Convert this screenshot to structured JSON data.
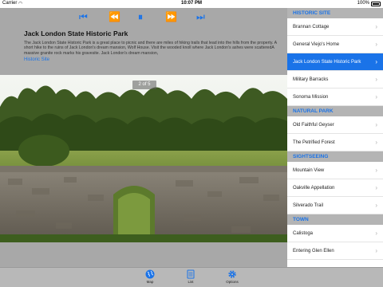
{
  "status_bar": {
    "carrier": "Carrier",
    "time": "10:07 PM",
    "battery": "100%"
  },
  "media": {
    "first": "⏮",
    "rewind": "⏪",
    "pause": "⏸",
    "ffwd": "⏩",
    "last": "⏭"
  },
  "detail": {
    "title": "Jack London State Historic Park",
    "description": "The Jack London State Historic Park is a great place to picnic and there are miles of hiking trails that lead into the hills from the property. A short hike to the ruins of Jack London's dream mansion, Wolf House. Visit the wooded knoll where Jack London's ashes were scatteredA massive granite rock marks his gravesite. Jack London's dream mansion,",
    "link": "Historic Site",
    "photo_counter": "2 of 5"
  },
  "sidebar": {
    "sections": [
      {
        "header": "HISTORIC SITE",
        "items": [
          "Brannan Cottage",
          "General Viejo's Home",
          "Jack London State Historic Park",
          "Military Barracks",
          "Sonoma Mission"
        ]
      },
      {
        "header": "NATURAL PARK",
        "items": [
          "Old Faithful Geyser",
          "The Petrified Forest"
        ]
      },
      {
        "header": "SIGHTSEEING",
        "items": [
          "Mountain View",
          "Oakville Appellation",
          "Silverado Trail"
        ]
      },
      {
        "header": "TOWN",
        "items": [
          "Calistoga",
          "Entering Glen Ellen"
        ]
      }
    ],
    "selected": "Jack London State Historic Park"
  },
  "tabs": {
    "map": "Map",
    "list": "List",
    "options": "Options"
  },
  "colors": {
    "accent": "#1a73e8"
  }
}
